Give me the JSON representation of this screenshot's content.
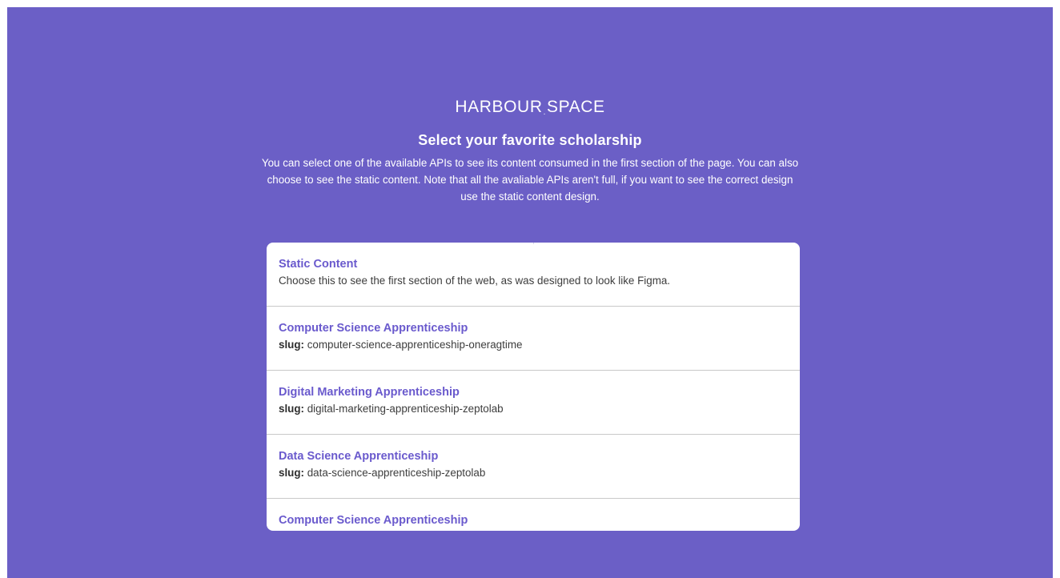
{
  "header": {
    "logo_left": "HARBOUR",
    "logo_dot": ".",
    "logo_right": "SPACE",
    "title": "Select your favorite scholarship",
    "description": "You can select one of the available APIs to see its content consumed in the first section of the page. You can also choose to see the static content. Note that all the avaliable APIs aren't full, if you want to see the correct design use the static content design."
  },
  "options": [
    {
      "title": "Static Content",
      "subtitle": "Choose this to see the first section of the web, as was designed to look like Figma."
    },
    {
      "title": "Computer Science Apprenticeship",
      "slug_label": "slug:",
      "slug": "computer-science-apprenticeship-oneragtime"
    },
    {
      "title": "Digital Marketing Apprenticeship",
      "slug_label": "slug:",
      "slug": "digital-marketing-apprenticeship-zeptolab"
    },
    {
      "title": "Data Science Apprenticeship",
      "slug_label": "slug:",
      "slug": "data-science-apprenticeship-zeptolab"
    },
    {
      "title": "Computer Science Apprenticeship"
    }
  ],
  "colors": {
    "background": "#6b5fc6",
    "accent": "#6a5acd",
    "card": "#ffffff"
  }
}
